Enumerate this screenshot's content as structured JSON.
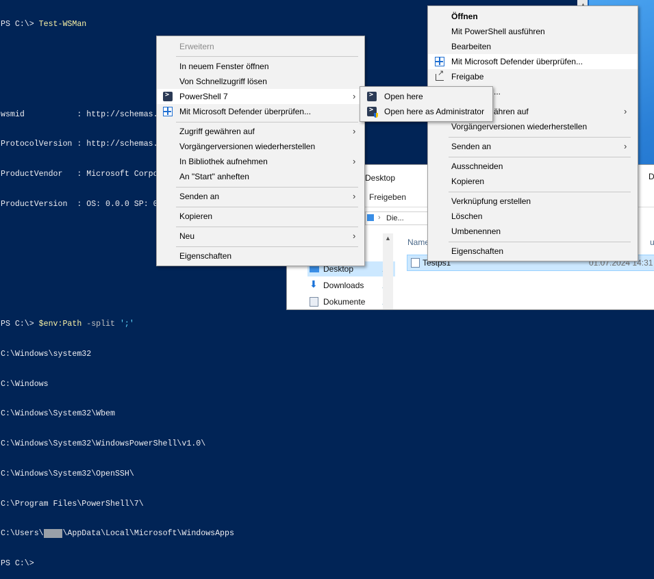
{
  "console": {
    "lines": [
      {
        "prompt": "PS C:\\> ",
        "cmd": "Test-WSMan",
        "rest": ""
      },
      {
        "text": ""
      },
      {
        "text": ""
      },
      {
        "text": "wsmid           : http://schemas.dmtf.org/wbem/wsman/identity/1/wsmanidentity.xsd"
      },
      {
        "text": "ProtocolVersion : http://schemas.dmtf.org/wbem/wsman/1/wsman.xsd"
      },
      {
        "text": "ProductVendor   : Microsoft Corporation"
      },
      {
        "text": "ProductVersion  : OS: 0.0.0 SP: 0.0 Stack: 3.0"
      },
      {
        "text": ""
      },
      {
        "text": ""
      },
      {
        "text": ""
      },
      {
        "prompt": "PS C:\\> ",
        "cmd": "$env:Path",
        "par": " -split ",
        "str": "';'"
      },
      {
        "text": "C:\\Windows\\system32"
      },
      {
        "text": "C:\\Windows"
      },
      {
        "text": "C:\\Windows\\System32\\Wbem"
      },
      {
        "text": "C:\\Windows\\System32\\WindowsPowerShell\\v1.0\\"
      },
      {
        "text": "C:\\Windows\\System32\\OpenSSH\\"
      },
      {
        "text": "C:\\Program Files\\PowerShell\\7\\"
      },
      {
        "pre": "C:\\Users\\",
        "redact": "xxxx",
        "post": "\\AppData\\Local\\Microsoft\\WindowsApps"
      },
      {
        "prompt": "PS C:\\> ",
        "cmd": "",
        "rest": ""
      }
    ]
  },
  "explorer": {
    "title": "Desktop",
    "window_control": "D",
    "ribbon_tab": "Freigeben",
    "address_parts": [
      "Die...",
      "De"
    ],
    "column_name": "Name",
    "column_date": "um",
    "nav_items": [
      {
        "label": "Desktop",
        "icon": "folder-desktop-icon",
        "pin": "📌"
      },
      {
        "label": "Downloads",
        "icon": "download-icon",
        "pin": "📌"
      },
      {
        "label": "Dokumente",
        "icon": "document-folder-icon",
        "pin": "📌"
      }
    ],
    "file": {
      "name": "Testps1",
      "date": "01.07.2024 14:31"
    }
  },
  "menu_left": {
    "items": [
      {
        "label": "Erweitern",
        "disabled": true
      },
      {
        "sep": true
      },
      {
        "label": "In neuem Fenster öffnen"
      },
      {
        "label": "Von Schnellzugriff lösen"
      },
      {
        "label": "PowerShell 7",
        "icon": "powershell-icon",
        "submenu": true,
        "highlight": true
      },
      {
        "label": "Mit Microsoft Defender überprüfen...",
        "icon": "defender-icon"
      },
      {
        "sep": true
      },
      {
        "label": "Zugriff gewähren auf",
        "submenu": true
      },
      {
        "label": "Vorgängerversionen wiederherstellen"
      },
      {
        "label": "In Bibliothek aufnehmen",
        "submenu": true
      },
      {
        "label": "An \"Start\" anheften"
      },
      {
        "sep": true
      },
      {
        "label": "Senden an",
        "submenu": true
      },
      {
        "sep": true
      },
      {
        "label": "Kopieren"
      },
      {
        "sep": true
      },
      {
        "label": "Neu",
        "submenu": true
      },
      {
        "sep": true
      },
      {
        "label": "Eigenschaften"
      }
    ]
  },
  "menu_sub": {
    "items": [
      {
        "label": "Open here",
        "icon": "powershell-icon"
      },
      {
        "label": "Open here as Administrator",
        "icon": "powershell-admin-icon"
      }
    ]
  },
  "menu_right": {
    "items": [
      {
        "label": "Öffnen",
        "bold": true
      },
      {
        "label": "Mit PowerShell ausführen"
      },
      {
        "label": "Bearbeiten"
      },
      {
        "label": "Mit Microsoft Defender überprüfen...",
        "icon": "defender-icon",
        "highlight": true
      },
      {
        "label": "Freigabe",
        "icon": "share-icon"
      },
      {
        "label": "...",
        "partial": true
      },
      {
        "label": "ähren auf",
        "partial": true,
        "submenu": true
      },
      {
        "label": "Vorgängerversionen wiederherstellen"
      },
      {
        "sep": true
      },
      {
        "label": "Senden an",
        "submenu": true
      },
      {
        "sep": true
      },
      {
        "label": "Ausschneiden"
      },
      {
        "label": "Kopieren"
      },
      {
        "sep": true
      },
      {
        "label": "Verknüpfung erstellen"
      },
      {
        "label": "Löschen"
      },
      {
        "label": "Umbenennen"
      },
      {
        "sep": true
      },
      {
        "label": "Eigenschaften"
      }
    ]
  }
}
